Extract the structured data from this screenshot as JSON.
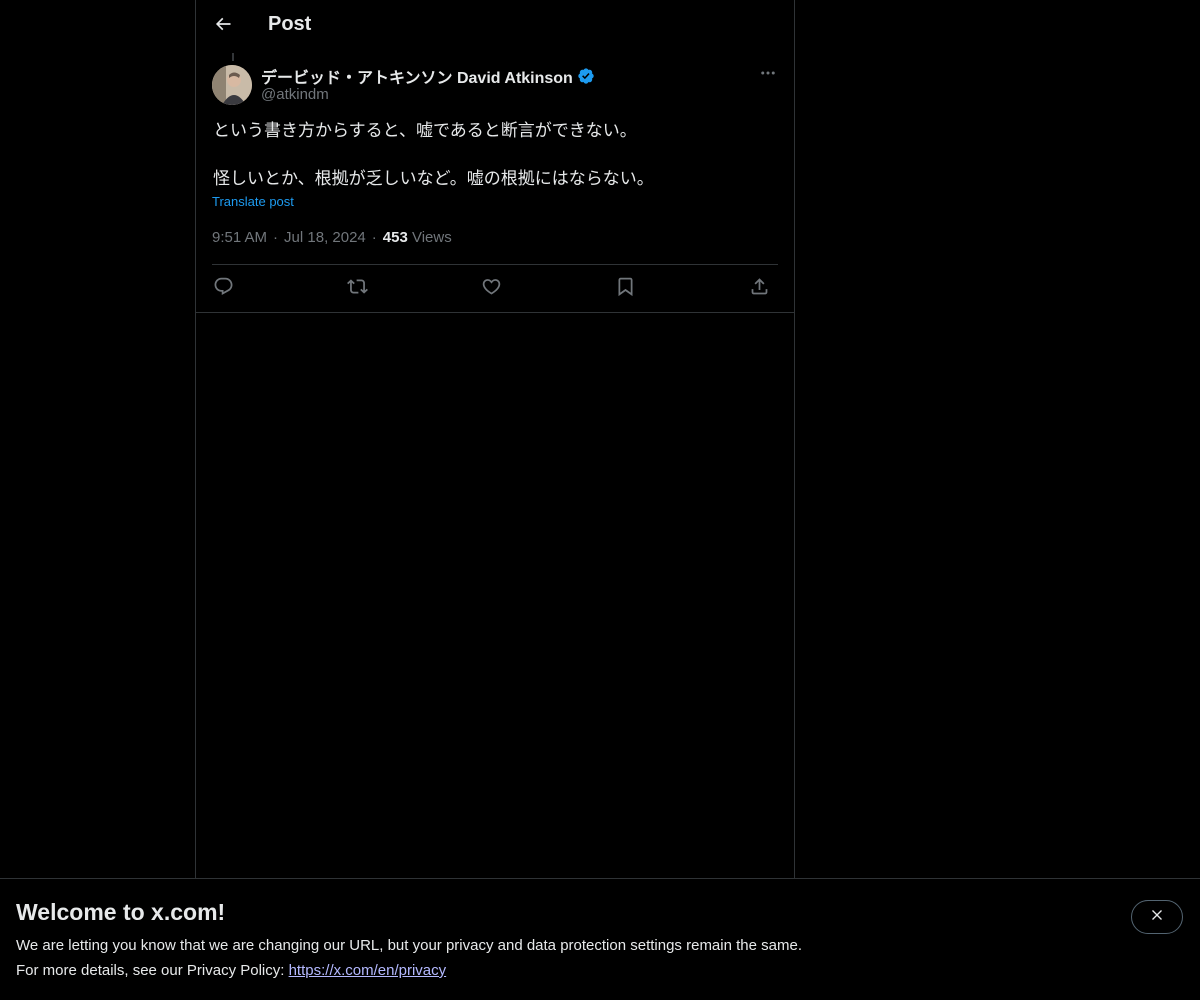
{
  "header": {
    "title": "Post"
  },
  "post": {
    "author_name": "デービッド・アトキンソン David Atkinson",
    "handle": "@atkindm",
    "verified": true,
    "text_line1": "という書き方からすると、嘘であると断言ができない。",
    "text_line2": "怪しいとか、根拠が乏しいなど。嘘の根拠にはならない。",
    "translate_label": "Translate post",
    "time": "9:51 AM",
    "date": "Jul 18, 2024",
    "views_count": "453",
    "views_label": "Views"
  },
  "actions": [
    {
      "name": "reply",
      "icon": "reply-icon"
    },
    {
      "name": "repost",
      "icon": "repost-icon"
    },
    {
      "name": "like",
      "icon": "like-icon"
    },
    {
      "name": "bookmark",
      "icon": "bookmark-icon"
    },
    {
      "name": "share",
      "icon": "share-icon"
    }
  ],
  "banner": {
    "title": "Welcome to x.com!",
    "line1": "We are letting you know that we are changing our URL, but your privacy and data protection settings remain the same.",
    "line2_prefix": "For more details, see our Privacy Policy: ",
    "link_text": "https://x.com/en/privacy"
  },
  "colors": {
    "background": "#000000",
    "text_primary": "#e7e9ea",
    "text_secondary": "#71767b",
    "accent": "#1d9bf0",
    "link": "#b4b9ff",
    "border": "#2f3336"
  }
}
